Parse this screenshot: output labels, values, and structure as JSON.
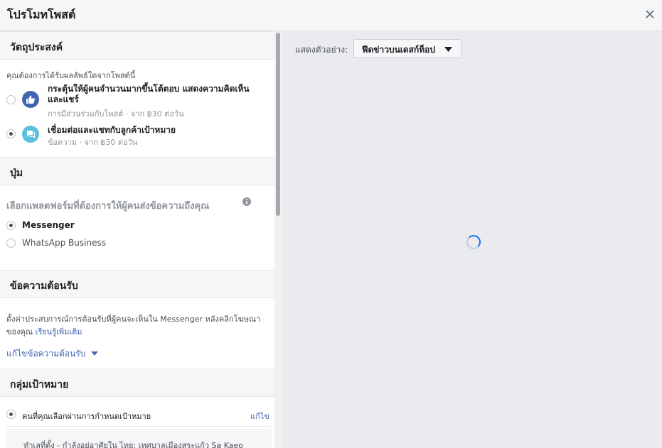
{
  "header": {
    "title": "โปรโมทโพสต์"
  },
  "objective": {
    "heading": "วัตถุประสงค์",
    "question": "คุณต้องการได้รับผลลัพธ์ใดจากโพสต์นี้",
    "options": [
      {
        "title": "กระตุ้นให้ผู้คนจำนวนมากขึ้นโต้ตอบ แสดงความคิดเห็นและแชร์",
        "sub": "การมีส่วนร่วมกับโพสต์ · จาก ฿30 ต่อวัน",
        "icon": "thumbs-up-icon",
        "color": "#4267b2",
        "selected": false
      },
      {
        "title": "เชื่อมต่อและแชทกับลูกค้าเป้าหมาย",
        "sub": "ข้อความ · จาก ฿30 ต่อวัน",
        "icon": "chat-bubble-icon",
        "color": "#5bc0de",
        "selected": true
      }
    ]
  },
  "button": {
    "heading": "ปุ่ม",
    "platform_question": "เลือกแพลตฟอร์มที่ต้องการให้ผู้คนส่งข้อความถึงคุณ",
    "platforms": [
      {
        "label": "Messenger",
        "selected": true
      },
      {
        "label": "WhatsApp Business",
        "selected": false
      }
    ]
  },
  "welcome": {
    "heading": "ข้อความต้อนรับ",
    "desc_line1": "ตั้งค่าประสบการณ์การต้อนรับที่ผู้คนจะเห็นใน Messenger หลังคลิกโฆษณา",
    "desc_line2": "ของคุณ",
    "learn_more": "เรียนรู้เพิ่มเติม",
    "edit": "แก้ไขข้อความต้อนรับ"
  },
  "audience": {
    "heading": "กลุ่มเป้าหมาย",
    "option": "คนที่คุณเลือกผ่านการกำหนดเป้าหมาย",
    "edit": "แก้ไข",
    "details": "ทำเลที่ตั้ง - กำลังอยู่อาศัยใน ไทย: เทศบาลเมืองสระแก้ว Sa Kaeo"
  },
  "preview": {
    "label": "แสดงตัวอย่าง:",
    "selected": "ฟีดข่าวบนเดสก์ท็อป"
  },
  "colors": {
    "accent": "#1877f2",
    "link": "#4267b2"
  }
}
